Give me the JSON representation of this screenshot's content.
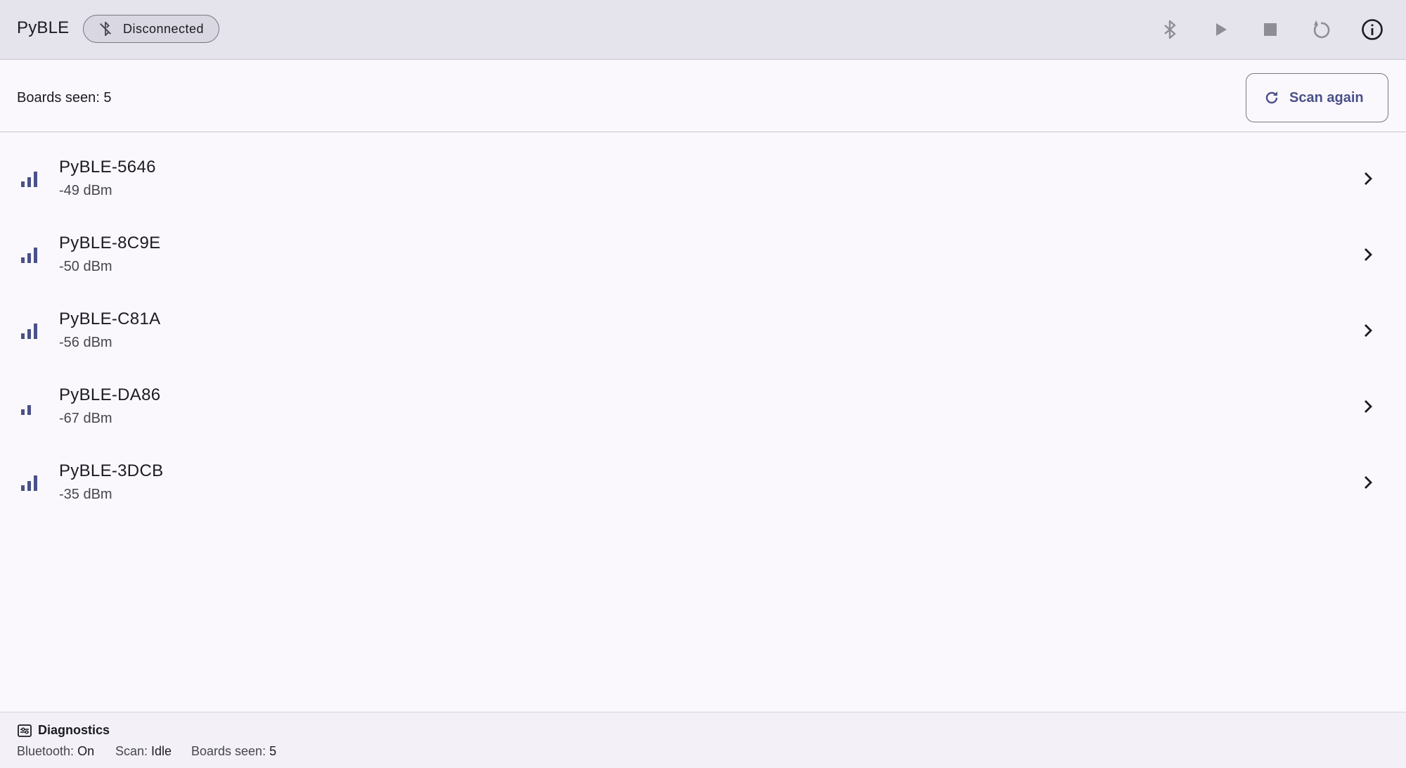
{
  "app": {
    "title": "PyBLE",
    "status": "Disconnected"
  },
  "toolbar": {
    "icons": [
      "bluetooth-icon",
      "play-icon",
      "stop-icon",
      "reset-icon",
      "info-icon"
    ]
  },
  "summary": {
    "boards_seen": "Boards seen: 5",
    "scan_label": "Scan again"
  },
  "devices": [
    {
      "name": "PyBLE-5646",
      "rssi": "-49 dBm",
      "bars": 3
    },
    {
      "name": "PyBLE-8C9E",
      "rssi": "-50 dBm",
      "bars": 3
    },
    {
      "name": "PyBLE-C81A",
      "rssi": "-56 dBm",
      "bars": 3
    },
    {
      "name": "PyBLE-DA86",
      "rssi": "-67 dBm",
      "bars": 2
    },
    {
      "name": "PyBLE-3DCB",
      "rssi": "-35 dBm",
      "bars": 3
    }
  ],
  "diagnostics": {
    "title": "Diagnostics",
    "bluetooth_key": "Bluetooth:",
    "bluetooth_val": "On",
    "scan_key": "Scan:",
    "scan_val": "Idle",
    "boards_key": "Boards seen:",
    "boards_val": "5"
  },
  "colors": {
    "accent": "#4a5189",
    "appbar": "#e5e3ec",
    "background": "#fbf8fd",
    "icon_muted": "#8e8d96"
  }
}
